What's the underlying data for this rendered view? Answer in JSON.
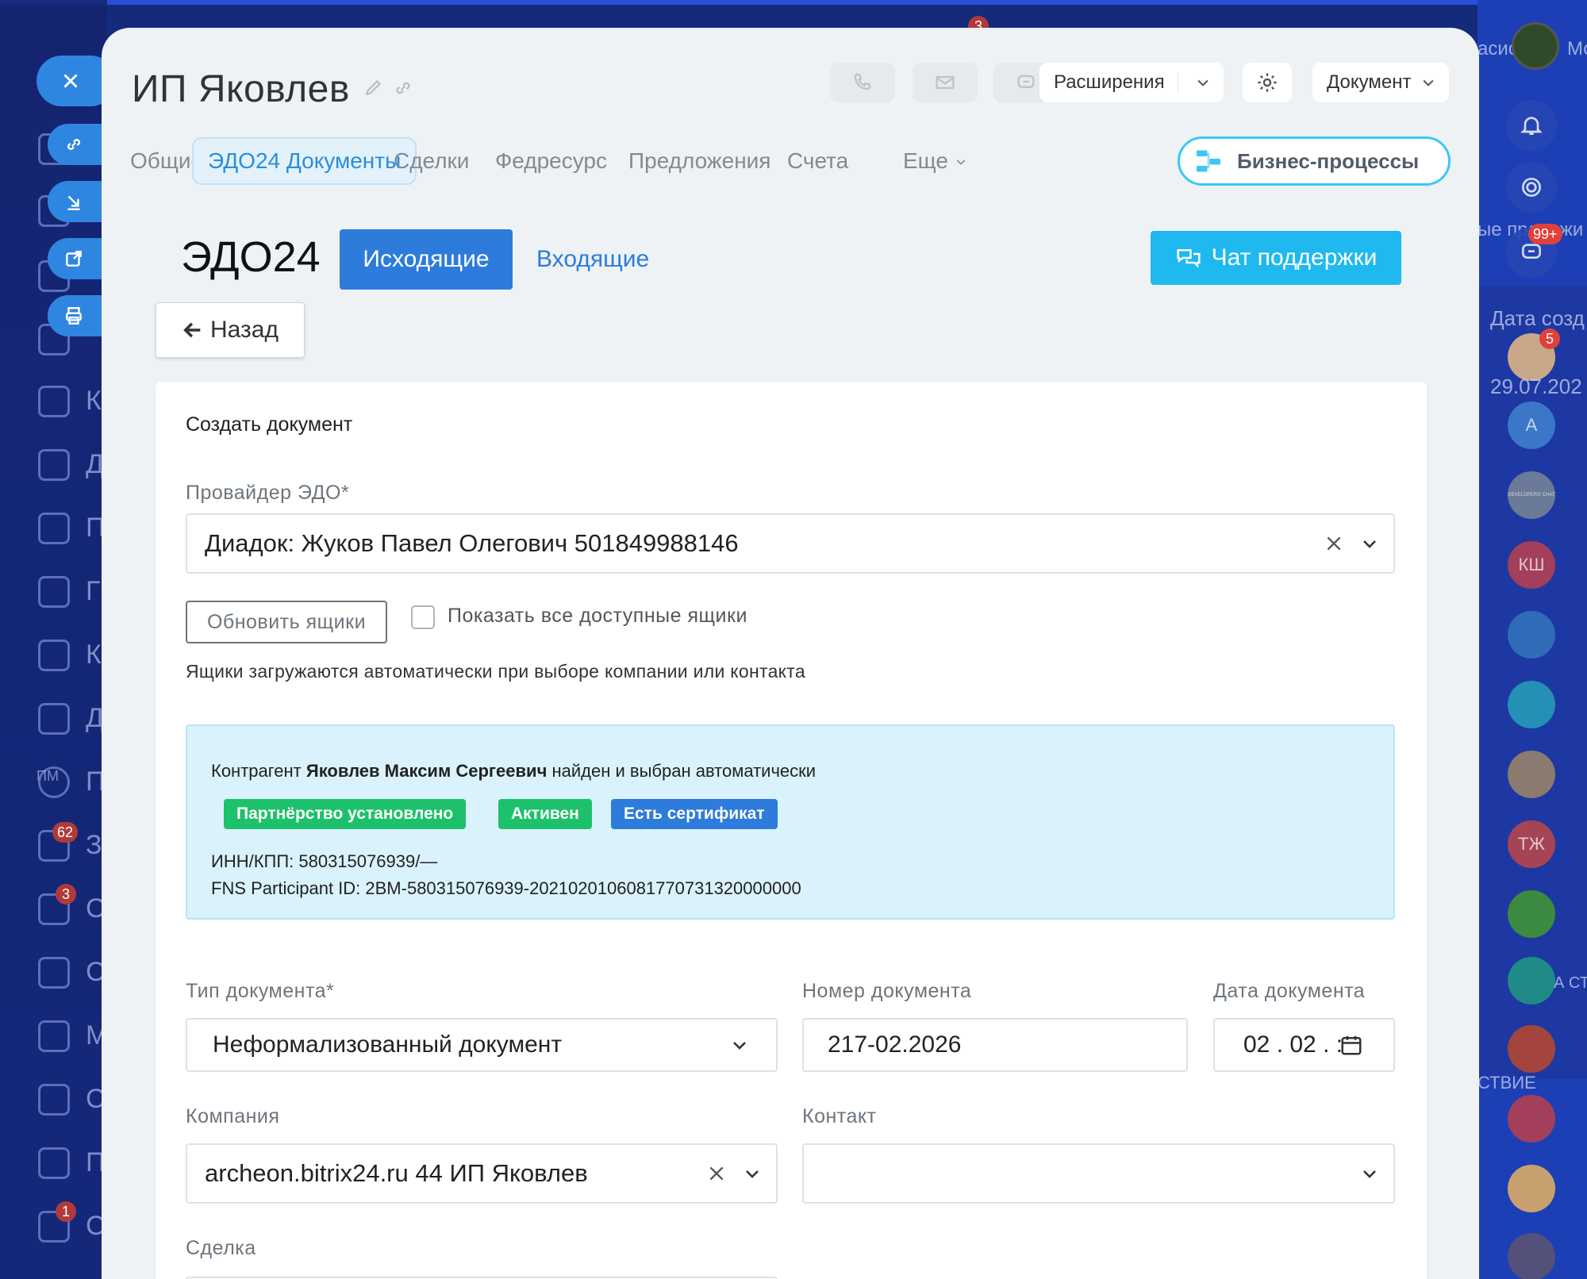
{
  "panel": {
    "title": "ИП Яковлев",
    "header_buttons": {
      "extensions": "Расширения",
      "document": "Документ"
    },
    "tabs": [
      {
        "label": "Общие"
      },
      {
        "label": "ЭДО24 Документы"
      },
      {
        "label": "Сделки"
      },
      {
        "label": "Федресурс"
      },
      {
        "label": "Предложения"
      },
      {
        "label": "Счета"
      },
      {
        "label": "Еще"
      }
    ],
    "business_processes": "Бизнес-процессы"
  },
  "edo": {
    "title": "ЭДО24",
    "outgoing": "Исходящие",
    "incoming": "Входящие",
    "support_chat": "Чат поддержки",
    "back": "Назад"
  },
  "form": {
    "card_title": "Создать документ",
    "provider_label": "Провайдер ЭДО*",
    "provider_value": "Диадок: Жуков Павел Олегович 501849988146",
    "refresh_boxes": "Обновить ящики",
    "show_all_boxes": "Показать все доступные ящики",
    "boxes_hint": "Ящики загружаются автоматически при выборе компании или контакта",
    "counterparty": {
      "prefix": "Контрагент",
      "name": "Яковлев Максим Сергеевич",
      "suffix": "найден и выбран автоматически",
      "badges": [
        "Партнёрство установлено",
        "Активен",
        "Есть сертификат"
      ],
      "inn_kpp": "ИНН/КПП: 580315076939/—",
      "fns_id": "FNS Participant ID: 2BM-580315076939-2021020106081770731320000000"
    },
    "doc_type_label": "Тип документа*",
    "doc_type_value": "Неформализованный документ",
    "doc_number_label": "Номер документа",
    "doc_number_value": "217-02.2026",
    "doc_date_label": "Дата документа",
    "doc_date_value": "02 . 02 . :",
    "company_label": "Компания",
    "company_value": "archeon.bitrix24.ru 44 ИП Яковлев",
    "contact_label": "Контакт",
    "contact_value": "",
    "deal_label": "Сделка",
    "deal_value": ""
  },
  "background": {
    "badges": [
      "3",
      "62",
      "3",
      "1"
    ],
    "left_sidebar_initial": [
      "К",
      "Д",
      "П",
      "Г",
      "К",
      "Д",
      "П",
      "З",
      "С",
      "С",
      "М",
      "С",
      "П",
      "С"
    ],
    "pm_initials": "ПМ",
    "right_labels": {
      "top_cut": "асис",
      "user_cut": "Мо",
      "products_cut": "ые продажи",
      "date_created_cut": "Дата созд",
      "date_value_cut": "29.07.202",
      "status_cut": "СТВИЕ",
      "st_cut": "А СТ"
    },
    "right_badges": [
      "99+",
      "5"
    ],
    "avatars": [
      "А",
      "КШ",
      "ТЖ"
    ],
    "developers_chat": "DEVELOPERS' CHAT"
  },
  "colors": {
    "accent": "#2d7cdb",
    "chat": "#20b9ef",
    "partnership_badge": "#1ec16b",
    "active_badge": "#1ec16b",
    "certificate_badge": "#2d7cdb",
    "info_box": "#d9f2fc"
  }
}
